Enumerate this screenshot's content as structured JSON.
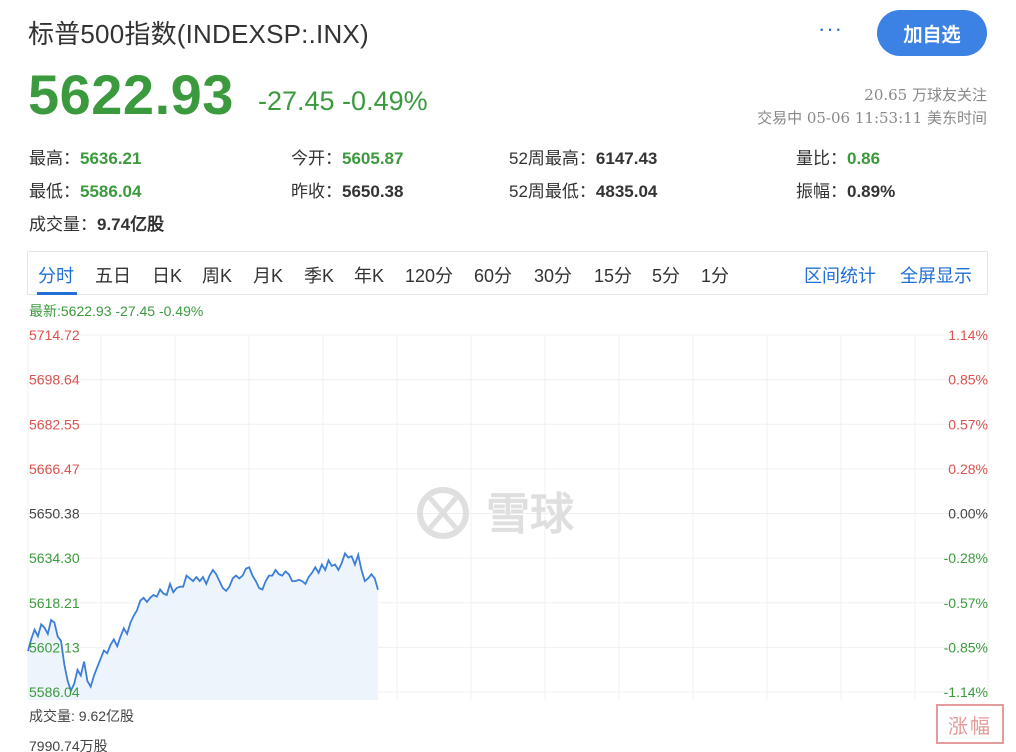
{
  "header": {
    "title": "标普500指数(INDEXSP:.INX)",
    "more": "···",
    "follow_button": "加自选"
  },
  "quote": {
    "price": "5622.93",
    "change": "-27.45 -0.49%",
    "followers": "20.65 万球友关注",
    "trade_time": "交易中 05-06 11:53:11 美东时间"
  },
  "stats": {
    "high_label": "最高：",
    "high": "5636.21",
    "low_label": "最低：",
    "low": "5586.04",
    "volume_label": "成交量：",
    "volume": "9.74亿股",
    "open_label": "今开：",
    "open": "5605.87",
    "prev_close_label": "昨收：",
    "prev_close": "5650.38",
    "w52_high_label": "52周最高：",
    "w52_high": "6147.43",
    "w52_low_label": "52周最低：",
    "w52_low": "4835.04",
    "vol_ratio_label": "量比：",
    "vol_ratio": "0.86",
    "amplitude_label": "振幅：",
    "amplitude": "0.89%"
  },
  "tabs": {
    "items": [
      "分时",
      "五日",
      "日K",
      "周K",
      "月K",
      "季K",
      "年K",
      "120分",
      "60分",
      "30分",
      "15分",
      "5分",
      "1分"
    ],
    "active": "分时",
    "range_stats": "区间统计",
    "fullscreen": "全屏显示"
  },
  "latest_line": "最新:5622.93 -27.45 -0.49%",
  "watermark": "雪球",
  "volume_panel": {
    "label": "成交量: 9.62亿股",
    "sub": "7990.74万股"
  },
  "stamp": "涨幅",
  "colors": {
    "green": "#3c9a3e",
    "red": "#d9534f",
    "blue": "#1f6fd6",
    "line": "#3b7fd9",
    "fill": "#eef4fc"
  },
  "chart_data": {
    "type": "line",
    "title": "",
    "series": [
      {
        "values": [
          5600.8,
          5605.2,
          5608.5,
          5606.1,
          5610.4,
          5609.2,
          5607.0,
          5612.0,
          5611.1,
          5606.0,
          5604.5,
          5596.0,
          5590.1,
          5586.5,
          5589.0,
          5594.0,
          5592.0,
          5597.0,
          5590.0,
          5588.0,
          5592.0,
          5595.0,
          5598.0,
          5601.0,
          5600.0,
          5603.0,
          5605.0,
          5602.5,
          5606.0,
          5609.0,
          5607.0,
          5611.0,
          5613.5,
          5615.5,
          5619.0,
          5620.0,
          5618.5,
          5620.0,
          5621.0,
          5620.4,
          5623.0,
          5621.5,
          5621.0,
          5625.0,
          5622.0,
          5623.5,
          5624.0,
          5624.0,
          5628.0,
          5627.0,
          5626.0,
          5627.5,
          5626.0,
          5627.5,
          5625.0,
          5628.0,
          5630.0,
          5628.5,
          5626.0,
          5623.5,
          5622.5,
          5624.0,
          5627.0,
          5628.0,
          5627.0,
          5628.0,
          5630.5,
          5631.0,
          5628.0,
          5626.0,
          5623.5,
          5623.0,
          5626.0,
          5628.0,
          5628.0,
          5630.0,
          5628.5,
          5628.0,
          5629.5,
          5628.5,
          5626.0,
          5626.0,
          5626.5,
          5626.0,
          5625.0,
          5627.5,
          5629.0,
          5631.0,
          5629.0,
          5632.0,
          5630.0,
          5633.5,
          5631.5,
          5632.0,
          5630.0,
          5632.5,
          5636.0,
          5634.5,
          5635.0,
          5632.0,
          5635.5,
          5630.0,
          5626.0,
          5627.0,
          5628.5,
          5627.0,
          5622.93
        ]
      }
    ],
    "ylim": [
      5586.04,
      5714.72
    ],
    "y_ticks_left": [
      "5714.72",
      "5698.64",
      "5682.55",
      "5666.47",
      "5650.38",
      "5634.30",
      "5618.21",
      "5602.13",
      "5586.04"
    ],
    "y_ticks_right": [
      "1.14%",
      "0.85%",
      "0.57%",
      "0.28%",
      "0.00%",
      "-0.28%",
      "-0.57%",
      "-0.85%",
      "-1.14%"
    ],
    "prev_close": 5650.38,
    "grid": true
  }
}
